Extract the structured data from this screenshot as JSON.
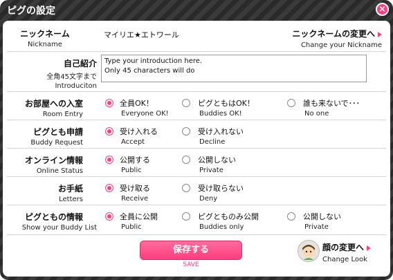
{
  "window": {
    "title": "ピグの設定",
    "close_icon": "×"
  },
  "nickname": {
    "label": "ニックネーム",
    "label_en": "Nickname",
    "value": "マイリエ★エトワール",
    "change_label": "ニックネームの変更へ",
    "change_label_en": "Change your Nickname"
  },
  "intro": {
    "label": "自己紹介",
    "note": "全角45文字まで",
    "label_en": "Introduciton",
    "placeholder_line1": "Type your introduction here.",
    "placeholder_line2": "Only 45 characters will do"
  },
  "settings": [
    {
      "label": "お部屋への入室",
      "label_en": "Room Entry",
      "selected": 0,
      "options": [
        {
          "label": "全員OK！",
          "label_en": "Everyone OK!"
        },
        {
          "label": "ピグともはOK！",
          "label_en": "Buddies OK!"
        },
        {
          "label": "誰も来ないで･･･",
          "label_en": "No one"
        }
      ]
    },
    {
      "label": "ピグとも申請",
      "label_en": "Buddy Request",
      "selected": 0,
      "options": [
        {
          "label": "受け入れる",
          "label_en": "Accept"
        },
        {
          "label": "受け入れない",
          "label_en": "Decline"
        }
      ]
    },
    {
      "label": "オンライン情報",
      "label_en": "Online Status",
      "selected": 0,
      "options": [
        {
          "label": "公開する",
          "label_en": "Public"
        },
        {
          "label": "公開しない",
          "label_en": "Private"
        }
      ]
    },
    {
      "label": "お手紙",
      "label_en": "Letters",
      "selected": 0,
      "options": [
        {
          "label": "受け取る",
          "label_en": "Receive"
        },
        {
          "label": "受け取らない",
          "label_en": "Deny"
        }
      ]
    },
    {
      "label": "ピグともの情報",
      "label_en": "Show your Buddy List",
      "selected": 0,
      "options": [
        {
          "label": "全員に公開",
          "label_en": "Public"
        },
        {
          "label": "ピグとものみ公開",
          "label_en": "Buddies only"
        },
        {
          "label": "公開しない",
          "label_en": "Private"
        }
      ]
    }
  ],
  "save": {
    "label": "保存する",
    "label_en": "SAVE"
  },
  "look": {
    "label": "顔の変更へ",
    "label_en": "Change Look"
  },
  "colors": {
    "accent": "#ff3d7f",
    "frame": "#2a2a2a"
  }
}
